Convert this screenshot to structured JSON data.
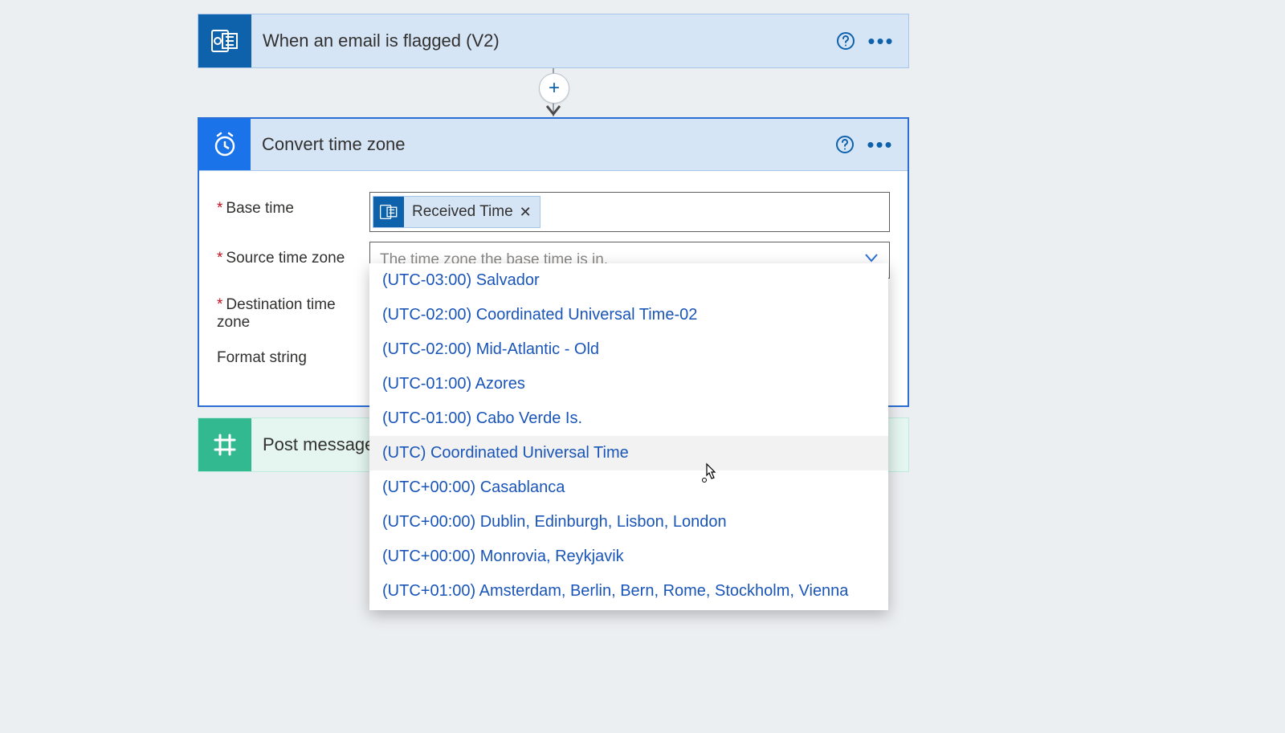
{
  "trigger": {
    "title": "When an email is flagged (V2)"
  },
  "action": {
    "title": "Convert time zone",
    "fields": {
      "base_time": {
        "label": "Base time",
        "token_label": "Received Time",
        "token_icon": "outlook-icon"
      },
      "source_tz": {
        "label": "Source time zone",
        "placeholder": "The time zone the base time is in."
      },
      "dest_tz": {
        "label": "Destination time zone"
      },
      "format": {
        "label": "Format string"
      }
    }
  },
  "dropdown": {
    "highlighted_index": 5,
    "options": [
      "(UTC-03:00) Salvador",
      "(UTC-02:00) Coordinated Universal Time-02",
      "(UTC-02:00) Mid-Atlantic - Old",
      "(UTC-01:00) Azores",
      "(UTC-01:00) Cabo Verde Is.",
      "(UTC) Coordinated Universal Time",
      "(UTC+00:00) Casablanca",
      "(UTC+00:00) Dublin, Edinburgh, Lisbon, London",
      "(UTC+00:00) Monrovia, Reykjavik",
      "(UTC+01:00) Amsterdam, Berlin, Bern, Rome, Stockholm, Vienna"
    ]
  },
  "post": {
    "title": "Post message "
  }
}
